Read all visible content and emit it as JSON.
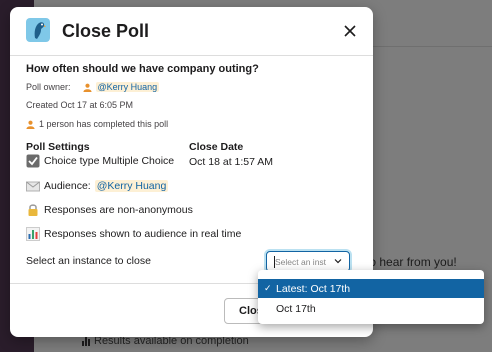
{
  "modal": {
    "title": "Close Poll",
    "question": "How often should we have company outing?",
    "poll_owner_label": "Poll owner:",
    "poll_owner": "@Kerry Huang",
    "created": "Created Oct 17 at 6:05 PM",
    "completed": "1 person has completed this poll",
    "poll_settings_heading": "Poll Settings",
    "close_date_heading": "Close Date",
    "close_date_value": "Oct 18 at 1:57 AM",
    "choice_type": "Choice type Multiple Choice",
    "audience_label": "Audience:",
    "audience_value": "@Kerry Huang",
    "anonymity": "Responses are non-anonymous",
    "visibility": "Responses shown to audience in real time",
    "instance_label": "Select an instance to close",
    "select_placeholder": "Select an inst",
    "footer_button": "Clos"
  },
  "dropdown": {
    "options": [
      {
        "label": "Latest: Oct 17th",
        "selected": true
      },
      {
        "label": "Oct 17th",
        "selected": false
      }
    ],
    "check_mark": "✓"
  },
  "background": {
    "message_fragment": "e to hear from you!",
    "results_text": "Results available on completion"
  },
  "colors": {
    "accent": "#1264a3",
    "mention_bg": "#fdf0d5",
    "app_icon_bg": "#7fc8e8"
  },
  "icons": [
    "parrot-app-icon",
    "close-icon",
    "person-icon",
    "checkbox-icon",
    "envelope-icon",
    "lock-icon",
    "bar-chart-icon",
    "chevron-down-icon"
  ]
}
